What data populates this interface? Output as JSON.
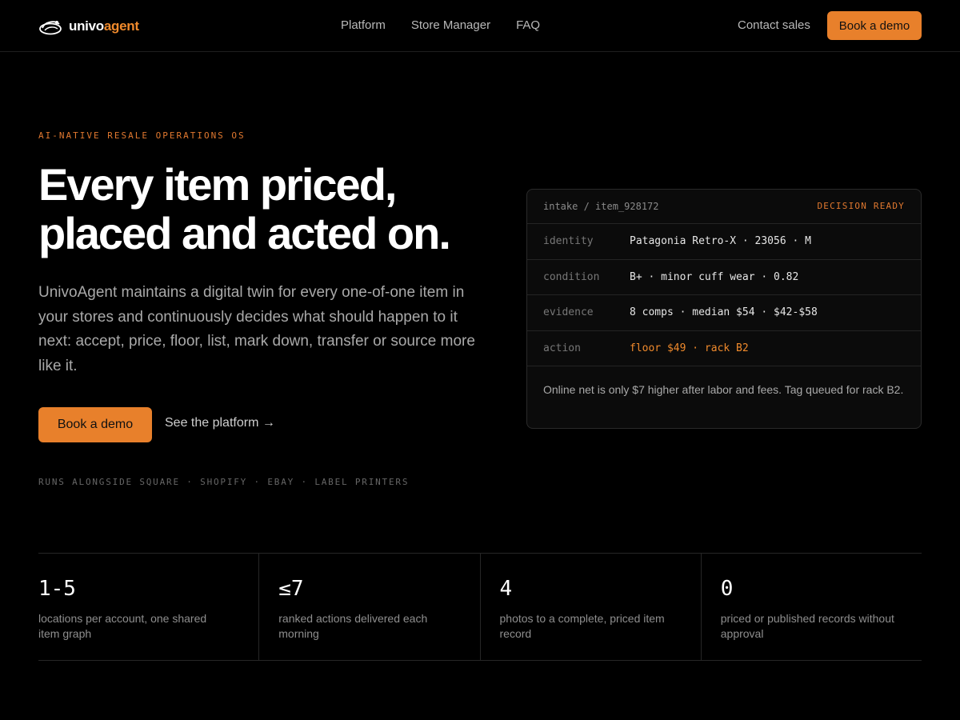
{
  "nav": {
    "logo_primary": "univo",
    "logo_accent": "agent",
    "links": [
      "Platform",
      "Store Manager",
      "FAQ"
    ],
    "contact": "Contact sales",
    "cta": "Book a demo"
  },
  "hero": {
    "eyebrow": "AI-NATIVE RESALE OPERATIONS OS",
    "headline_line1": "Every item priced,",
    "headline_line2": "placed and acted on.",
    "lede": "UnivoAgent maintains a digital twin for every one-of-one item in your stores and continuously decides what should happen to it next: accept, price, floor, list, mark down, transfer or source more like it.",
    "cta_primary": "Book a demo",
    "cta_secondary": "See the platform →",
    "integrations": "RUNS ALONGSIDE SQUARE · SHOPIFY · EBAY · LABEL PRINTERS"
  },
  "card": {
    "path": "intake / item_928172",
    "status": "DECISION READY",
    "rows": [
      {
        "key": "identity",
        "value": "Patagonia Retro-X · 23056 · M"
      },
      {
        "key": "condition",
        "value": "B+ · minor cuff wear · 0.82"
      },
      {
        "key": "evidence",
        "value": "8 comps · median $54 · $42-$58"
      },
      {
        "key": "action",
        "value": "floor $49 · rack B2"
      }
    ],
    "note": "Online net is only $7 higher after labor and fees. Tag queued for rack B2."
  },
  "stats": [
    {
      "value": "1-5",
      "desc": "locations per account, one shared item graph"
    },
    {
      "value": "≤7",
      "desc": "ranked actions delivered each morning"
    },
    {
      "value": "4",
      "desc": "photos to a complete, priced item record"
    },
    {
      "value": "0",
      "desc": "priced or published records without approval"
    }
  ],
  "colors": {
    "accent": "#e8802b",
    "background": "#000000",
    "muted_text": "#a9a9a9"
  }
}
